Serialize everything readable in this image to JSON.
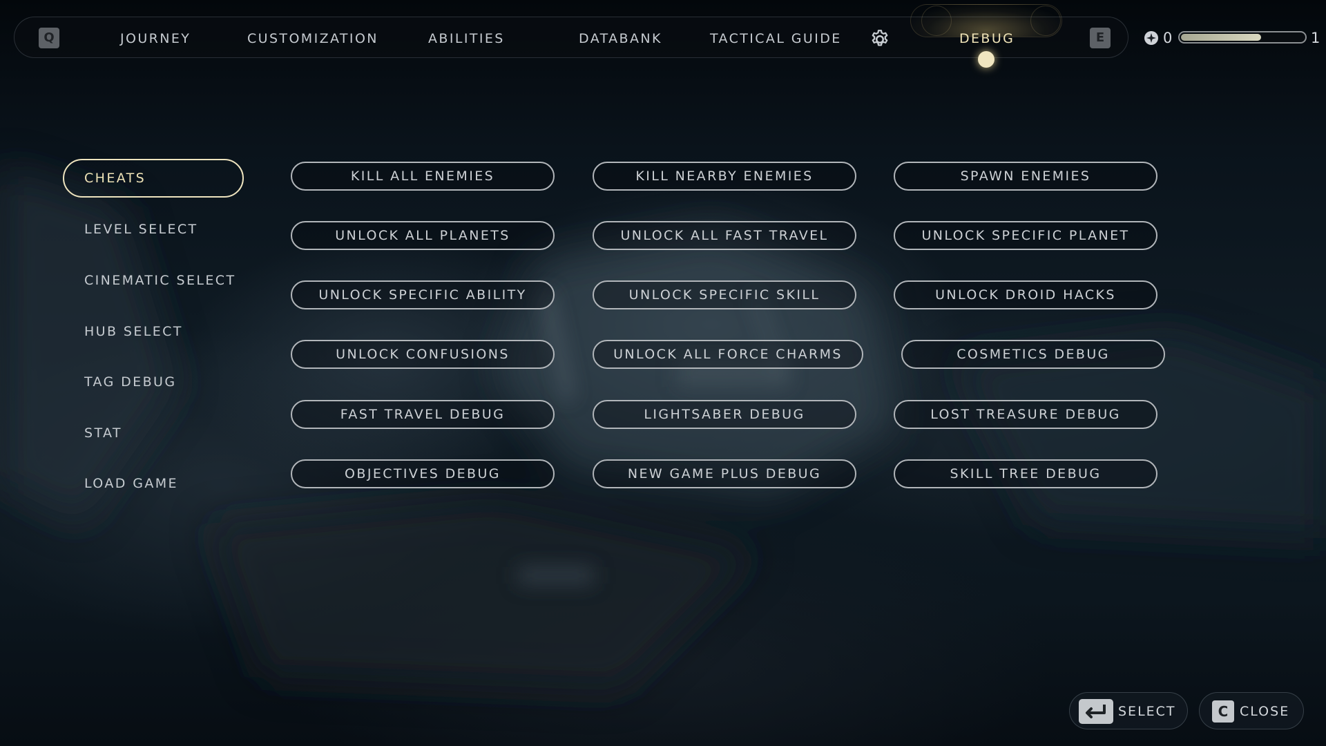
{
  "topnav": {
    "left_key": "Q",
    "right_key": "E",
    "tabs": [
      {
        "label": "JOURNEY"
      },
      {
        "label": "CUSTOMIZATION"
      },
      {
        "label": "ABILITIES"
      },
      {
        "label": "DATABANK"
      },
      {
        "label": "TACTICAL GUIDE"
      },
      {
        "label": "DEBUG",
        "active": true
      }
    ],
    "settings_icon": "gear-icon"
  },
  "xp": {
    "icon": "skill-point-icon",
    "level_start": "0",
    "level_end": "1",
    "progress": 0.65
  },
  "sidebar": {
    "items": [
      {
        "label": "CHEATS",
        "active": true
      },
      {
        "label": "LEVEL SELECT"
      },
      {
        "label": "CINEMATIC SELECT"
      },
      {
        "label": "HUB SELECT"
      },
      {
        "label": "TAG DEBUG"
      },
      {
        "label": "STAT"
      },
      {
        "label": "LOAD GAME"
      }
    ]
  },
  "cheats": {
    "buttons": [
      "KILL ALL ENEMIES",
      "KILL NEARBY ENEMIES",
      "SPAWN ENEMIES",
      "UNLOCK ALL PLANETS",
      "UNLOCK ALL FAST TRAVEL",
      "UNLOCK SPECIFIC PLANET",
      "UNLOCK SPECIFIC ABILITY",
      "UNLOCK SPECIFIC SKILL",
      "UNLOCK DROID HACKS",
      "UNLOCK CONFUSIONS",
      "UNLOCK ALL FORCE CHARMS",
      "COSMETICS DEBUG",
      "FAST TRAVEL DEBUG",
      "LIGHTSABER DEBUG",
      "LOST TREASURE DEBUG",
      "OBJECTIVES DEBUG",
      "NEW GAME PLUS DEBUG",
      "SKILL TREE DEBUG"
    ]
  },
  "prompts": {
    "select_label": "SELECT",
    "select_icon": "enter-key-icon",
    "close_key": "C",
    "close_label": "CLOSE"
  },
  "colors": {
    "accent": "#efe3b7",
    "text": "#c6cbd0",
    "border": "#b2b6ba",
    "background": "#0b131b"
  }
}
